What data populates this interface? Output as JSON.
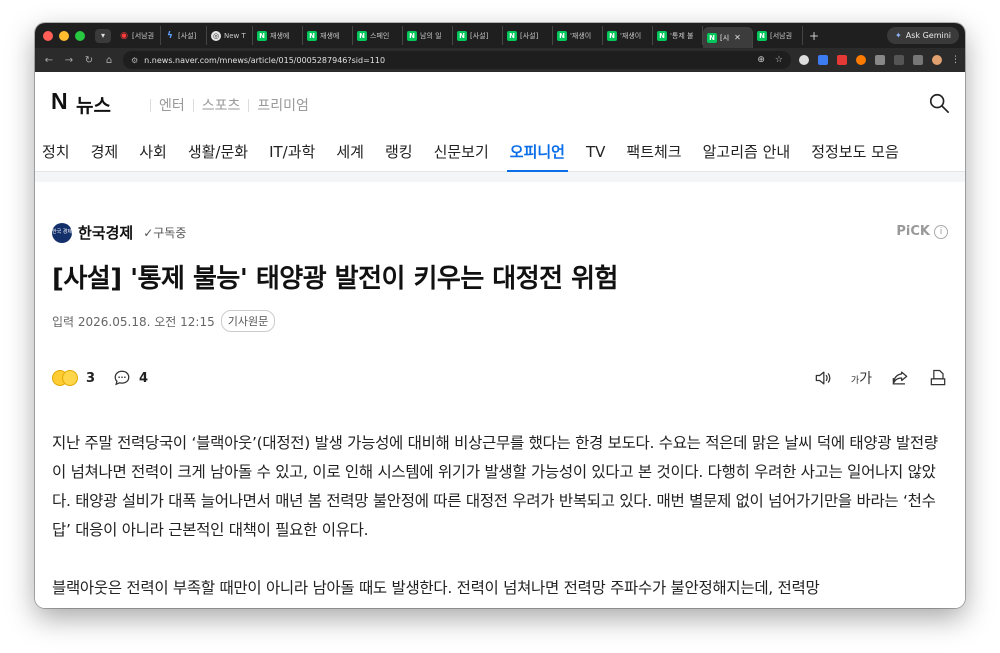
{
  "browser": {
    "tabs": [
      {
        "label": "[서남권",
        "fav": "red"
      },
      {
        "label": "[사설]",
        "fav": "blue"
      },
      {
        "label": "New T",
        "fav": "gh"
      },
      {
        "label": "재생에",
        "fav": "naver"
      },
      {
        "label": "재생에",
        "fav": "naver"
      },
      {
        "label": "스페인",
        "fav": "naver"
      },
      {
        "label": "남의 일",
        "fav": "naver"
      },
      {
        "label": "[사설]",
        "fav": "naver"
      },
      {
        "label": "[사설]",
        "fav": "naver"
      },
      {
        "label": "'재생이",
        "fav": "naver"
      },
      {
        "label": "'재생이",
        "fav": "naver"
      },
      {
        "label": "'통제 불",
        "fav": "naver"
      },
      {
        "label": "[시",
        "fav": "naver",
        "active": true
      },
      {
        "label": "[서남권",
        "fav": "naver"
      }
    ],
    "new_tab_label": "+",
    "gemini_label": "Ask Gemini",
    "url": "n.news.naver.com/mnews/article/015/0005287946?sid=110"
  },
  "header": {
    "logo_n": "N",
    "logo_news": "뉴스",
    "sub_links": [
      "엔터",
      "스포츠",
      "프리미엄"
    ]
  },
  "gnb": {
    "items": [
      "정치",
      "경제",
      "사회",
      "생활/문화",
      "IT/과학",
      "세계",
      "랭킹",
      "신문보기",
      "오피니언",
      "TV",
      "팩트체크",
      "알고리즘 안내",
      "정정보도 모음"
    ],
    "active_index": 8
  },
  "article": {
    "press_logo_text": "한국 경제",
    "press_name": "한국경제",
    "subscribe_label": "구독중",
    "pick_label": "PiCK",
    "pick_info": "i",
    "title": "[사설] '통제 불능' 태양광 발전이 키우는 대정전 위험",
    "dateline": "입력 2026.05.18. 오전 12:15",
    "original_button": "기사원문",
    "reaction_count": "3",
    "comment_count": "4",
    "font_tool_small": "가",
    "font_tool_big": "가",
    "paragraphs": [
      "지난 주말 전력당국이 ‘블랙아웃’(대정전) 발생 가능성에 대비해 비상근무를 했다는 한경 보도다. 수요는 적은데 맑은 날씨 덕에 태양광 발전량이 넘쳐나면 전력이 크게 남아돌 수 있고, 이로 인해 시스템에 위기가 발생할 가능성이 있다고 본 것이다. 다행히 우려한 사고는 일어나지 않았다. 태양광 설비가 대폭 늘어나면서 매년 봄 전력망 불안정에 따른 대정전 우려가 반복되고 있다. 매번 별문제 없이 넘어가기만을 바라는 ‘천수답’ 대응이 아니라 근본적인 대책이 필요한 이유다.",
      "블랙아웃은 전력이 부족할 때만이 아니라 남아돌 때도 발생한다. 전력이 넘쳐나면 전력망 주파수가 불안정해지는데, 전력망"
    ]
  },
  "colors": {
    "accent": "#0b6ee8",
    "naver_green": "#03c75a"
  }
}
